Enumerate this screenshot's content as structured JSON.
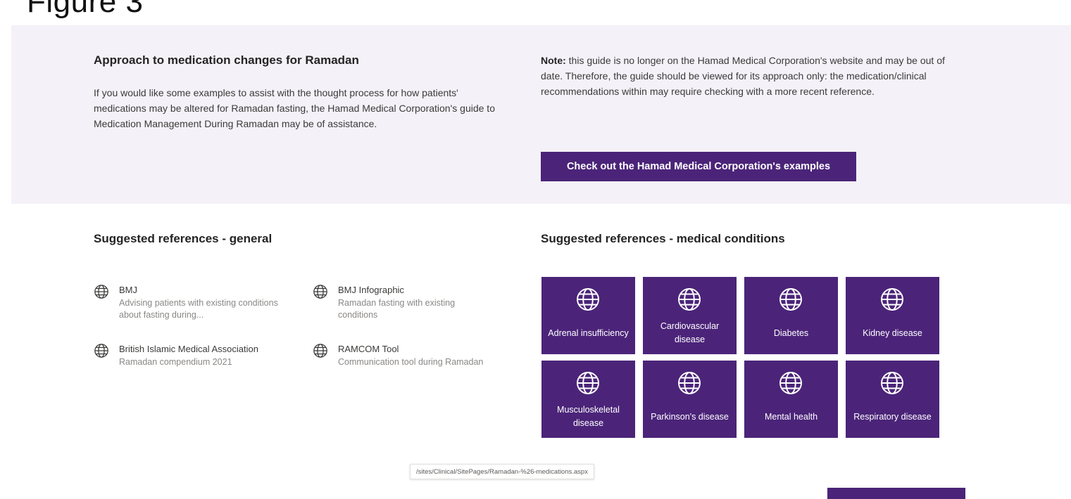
{
  "figure": {
    "label": "Figure 3"
  },
  "approach": {
    "heading": "Approach to medication changes for Ramadan",
    "body": "If you would like some examples to assist with the thought process for how patients' medications may be altered for Ramadan fasting, the Hamad Medical Corporation's guide to Medication Management During Ramadan may be of assistance."
  },
  "note": {
    "bold": "Note:",
    "text": " this guide is no longer on the Hamad Medical Corporation's website and may be out of date. Therefore, the guide should be viewed for its approach only: the medication/clinical recommendations within may require checking with a more recent reference.",
    "button_label": "Check out the Hamad Medical Corporation's examples"
  },
  "general_refs": {
    "heading": "Suggested references - general",
    "items": [
      {
        "title": "BMJ",
        "desc": "Advising patients with existing conditions about fasting during...",
        "icon": "globe-icon"
      },
      {
        "title": "BMJ Infographic",
        "desc": "Ramadan fasting with existing conditions",
        "icon": "globe-icon"
      },
      {
        "title": "British Islamic Medical Association",
        "desc": "Ramadan compendium 2021",
        "icon": "globe-icon"
      },
      {
        "title": "RAMCOM Tool",
        "desc": "Communication tool during Ramadan",
        "icon": "globe-icon"
      }
    ]
  },
  "medical_refs": {
    "heading": "Suggested references - medical conditions",
    "tiles": [
      {
        "label": "Adrenal insufficiency",
        "icon": "globe-icon"
      },
      {
        "label": "Cardiovascular disease",
        "icon": "globe-icon"
      },
      {
        "label": "Diabetes",
        "icon": "globe-icon"
      },
      {
        "label": "Kidney disease",
        "icon": "globe-icon"
      },
      {
        "label": "Musculoskeletal disease",
        "icon": "globe-icon"
      },
      {
        "label": "Parkinson's disease",
        "icon": "globe-icon"
      },
      {
        "label": "Mental health",
        "icon": "globe-icon"
      },
      {
        "label": "Respiratory disease",
        "icon": "globe-icon"
      }
    ]
  },
  "status_url": "/sites/Clinical/SitePages/Ramadan-%26-medications.aspx",
  "colors": {
    "accent": "#4b2479",
    "band_background": "#f5f1f8"
  }
}
